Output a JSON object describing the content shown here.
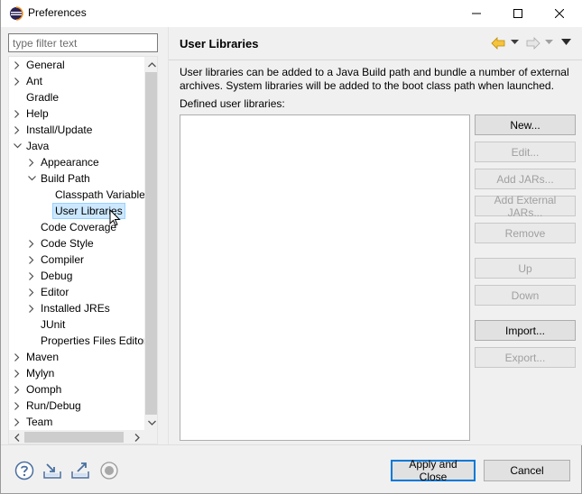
{
  "window": {
    "title": "Preferences"
  },
  "filter": {
    "placeholder": "type filter text",
    "value": ""
  },
  "tree": {
    "items": [
      {
        "label": "General",
        "level": 0,
        "expander": "collapsed"
      },
      {
        "label": "Ant",
        "level": 0,
        "expander": "collapsed"
      },
      {
        "label": "Gradle",
        "level": 0,
        "expander": "none"
      },
      {
        "label": "Help",
        "level": 0,
        "expander": "collapsed"
      },
      {
        "label": "Install/Update",
        "level": 0,
        "expander": "collapsed"
      },
      {
        "label": "Java",
        "level": 0,
        "expander": "expanded"
      },
      {
        "label": "Appearance",
        "level": 1,
        "expander": "collapsed"
      },
      {
        "label": "Build Path",
        "level": 1,
        "expander": "expanded"
      },
      {
        "label": "Classpath Variable",
        "level": 2,
        "expander": "none"
      },
      {
        "label": "User Libraries",
        "level": 2,
        "expander": "none",
        "selected": true
      },
      {
        "label": "Code Coverage",
        "level": 1,
        "expander": "none"
      },
      {
        "label": "Code Style",
        "level": 1,
        "expander": "collapsed"
      },
      {
        "label": "Compiler",
        "level": 1,
        "expander": "collapsed"
      },
      {
        "label": "Debug",
        "level": 1,
        "expander": "collapsed"
      },
      {
        "label": "Editor",
        "level": 1,
        "expander": "collapsed"
      },
      {
        "label": "Installed JREs",
        "level": 1,
        "expander": "collapsed"
      },
      {
        "label": "JUnit",
        "level": 1,
        "expander": "none"
      },
      {
        "label": "Properties Files Editor",
        "level": 1,
        "expander": "none"
      },
      {
        "label": "Maven",
        "level": 0,
        "expander": "collapsed"
      },
      {
        "label": "Mylyn",
        "level": 0,
        "expander": "collapsed"
      },
      {
        "label": "Oomph",
        "level": 0,
        "expander": "collapsed"
      },
      {
        "label": "Run/Debug",
        "level": 0,
        "expander": "collapsed"
      },
      {
        "label": "Team",
        "level": 0,
        "expander": "collapsed"
      }
    ]
  },
  "page": {
    "title": "User Libraries",
    "description": "User libraries can be added to a Java Build path and bundle a number of external archives. System libraries will be added to the boot class path when launched.",
    "list_label": "Defined user libraries:",
    "libraries": []
  },
  "buttons": {
    "new": {
      "label": "New...",
      "enabled": true
    },
    "edit": {
      "label": "Edit...",
      "enabled": false
    },
    "add_jars": {
      "label": "Add JARs...",
      "enabled": false
    },
    "add_external_jars": {
      "label": "Add External JARs...",
      "enabled": false
    },
    "remove": {
      "label": "Remove",
      "enabled": false
    },
    "up": {
      "label": "Up",
      "enabled": false
    },
    "down": {
      "label": "Down",
      "enabled": false
    },
    "import": {
      "label": "Import...",
      "enabled": true
    },
    "export": {
      "label": "Export...",
      "enabled": false
    }
  },
  "footer": {
    "apply_close": "Apply and Close",
    "cancel": "Cancel",
    "icons": [
      "help-icon",
      "import-preferences-icon",
      "export-preferences-icon",
      "record-icon"
    ]
  },
  "colors": {
    "selection_bg": "#cce8ff",
    "nav_back_arrow": "#f0b400",
    "default_button_border": "#0078d7"
  }
}
